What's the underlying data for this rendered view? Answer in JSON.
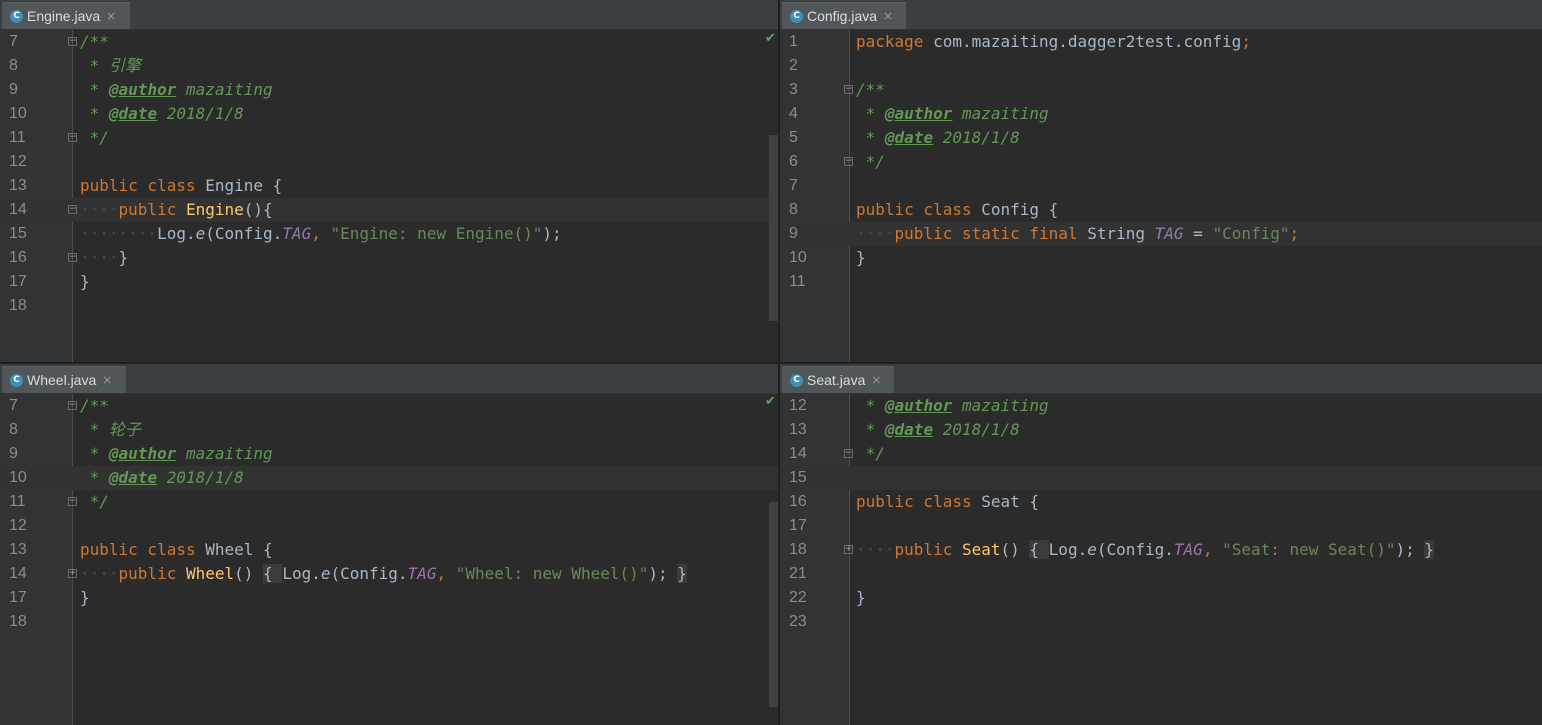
{
  "panes": {
    "engine": {
      "tab": {
        "label": "Engine.java",
        "close": "×"
      },
      "lines": [
        {
          "n": "7",
          "fold": "-",
          "tokens": [
            {
              "t": "/**",
              "c": "cm"
            }
          ]
        },
        {
          "n": "8",
          "tokens": [
            {
              "t": " * 引擎",
              "c": "cm"
            }
          ]
        },
        {
          "n": "9",
          "tokens": [
            {
              "t": " * ",
              "c": "cm"
            },
            {
              "t": "@author",
              "c": "tg"
            },
            {
              "t": " mazaiting",
              "c": "cm"
            }
          ]
        },
        {
          "n": "10",
          "tokens": [
            {
              "t": " * ",
              "c": "cm"
            },
            {
              "t": "@date",
              "c": "tg"
            },
            {
              "t": " 2018/1/8",
              "c": "cm"
            }
          ]
        },
        {
          "n": "11",
          "fold": "-",
          "tokens": [
            {
              "t": " */",
              "c": "cm"
            }
          ]
        },
        {
          "n": "12",
          "tokens": []
        },
        {
          "n": "13",
          "tokens": [
            {
              "t": "public class ",
              "c": "kw"
            },
            {
              "t": "Engine {",
              "c": "pl"
            }
          ]
        },
        {
          "n": "14",
          "fold": "-",
          "hl": true,
          "tokens": [
            {
              "t": "····",
              "c": "dot"
            },
            {
              "t": "public ",
              "c": "kw"
            },
            {
              "t": "Engine",
              "c": "fn"
            },
            {
              "t": "(){",
              "c": "pl"
            }
          ]
        },
        {
          "n": "15",
          "tokens": [
            {
              "t": "········",
              "c": "dot"
            },
            {
              "t": "Log.",
              "c": "pl"
            },
            {
              "t": "e",
              "c": "mi"
            },
            {
              "t": "(Config.",
              "c": "pl"
            },
            {
              "t": "TAG",
              "c": "cf"
            },
            {
              "t": ", ",
              "c": "kw"
            },
            {
              "t": "\"Engine: new Engine()\"",
              "c": "st"
            },
            {
              "t": ");",
              "c": "pl"
            }
          ]
        },
        {
          "n": "16",
          "fold": "-",
          "tokens": [
            {
              "t": "····",
              "c": "dot"
            },
            {
              "t": "}",
              "c": "pl"
            }
          ]
        },
        {
          "n": "17",
          "tokens": [
            {
              "t": "}",
              "c": "pl"
            }
          ]
        },
        {
          "n": "18",
          "tokens": []
        }
      ]
    },
    "config": {
      "tab": {
        "label": "Config.java",
        "close": "×"
      },
      "lines": [
        {
          "n": "1",
          "tokens": [
            {
              "t": "package ",
              "c": "kw"
            },
            {
              "t": "com.mazaiting.dagger2test.config",
              "c": "pl"
            },
            {
              "t": ";",
              "c": "kw"
            }
          ]
        },
        {
          "n": "2",
          "tokens": []
        },
        {
          "n": "3",
          "fold": "-",
          "tokens": [
            {
              "t": "/**",
              "c": "cm"
            }
          ]
        },
        {
          "n": "4",
          "tokens": [
            {
              "t": " * ",
              "c": "cm"
            },
            {
              "t": "@author",
              "c": "tg"
            },
            {
              "t": " mazaiting",
              "c": "cm"
            }
          ]
        },
        {
          "n": "5",
          "tokens": [
            {
              "t": " * ",
              "c": "cm"
            },
            {
              "t": "@date",
              "c": "tg"
            },
            {
              "t": " 2018/1/8",
              "c": "cm"
            }
          ]
        },
        {
          "n": "6",
          "fold": "-",
          "tokens": [
            {
              "t": " */",
              "c": "cm"
            }
          ]
        },
        {
          "n": "7",
          "tokens": []
        },
        {
          "n": "8",
          "tokens": [
            {
              "t": "public class ",
              "c": "kw"
            },
            {
              "t": "Config {",
              "c": "pl"
            }
          ]
        },
        {
          "n": "9",
          "hl": true,
          "tokens": [
            {
              "t": "····",
              "c": "dot"
            },
            {
              "t": "public static final ",
              "c": "kw"
            },
            {
              "t": "String ",
              "c": "pl"
            },
            {
              "t": "TAG",
              "c": "cf"
            },
            {
              "t": " = ",
              "c": "pl"
            },
            {
              "t": "\"Config\"",
              "c": "st"
            },
            {
              "t": ";",
              "c": "kw"
            }
          ]
        },
        {
          "n": "10",
          "tokens": [
            {
              "t": "}",
              "c": "pl"
            }
          ]
        },
        {
          "n": "11",
          "tokens": []
        }
      ]
    },
    "wheel": {
      "tab": {
        "label": "Wheel.java",
        "close": "×"
      },
      "lines": [
        {
          "n": "7",
          "fold": "-",
          "tokens": [
            {
              "t": "/**",
              "c": "cm"
            }
          ]
        },
        {
          "n": "8",
          "tokens": [
            {
              "t": " * 轮子",
              "c": "cm"
            }
          ]
        },
        {
          "n": "9",
          "tokens": [
            {
              "t": " * ",
              "c": "cm"
            },
            {
              "t": "@author",
              "c": "tg"
            },
            {
              "t": " mazaiting",
              "c": "cm"
            }
          ]
        },
        {
          "n": "10",
          "hl": true,
          "tokens": [
            {
              "t": " * ",
              "c": "cm"
            },
            {
              "t": "@date",
              "c": "tg"
            },
            {
              "t": " 2018/1/8",
              "c": "cm"
            }
          ]
        },
        {
          "n": "11",
          "fold": "-",
          "tokens": [
            {
              "t": " */",
              "c": "cm"
            }
          ]
        },
        {
          "n": "12",
          "tokens": []
        },
        {
          "n": "13",
          "tokens": [
            {
              "t": "public class ",
              "c": "kw"
            },
            {
              "t": "Wheel {",
              "c": "pl"
            }
          ]
        },
        {
          "n": "14",
          "fold": "+",
          "tokens": [
            {
              "t": "····",
              "c": "dot"
            },
            {
              "t": "public ",
              "c": "kw"
            },
            {
              "t": "Wheel",
              "c": "fn"
            },
            {
              "t": "() ",
              "c": "pl"
            },
            {
              "t": "{ ",
              "c": "folded"
            },
            {
              "t": "Log.",
              "c": "pl"
            },
            {
              "t": "e",
              "c": "mi"
            },
            {
              "t": "(Config.",
              "c": "pl"
            },
            {
              "t": "TAG",
              "c": "cf"
            },
            {
              "t": ", ",
              "c": "kw"
            },
            {
              "t": "\"Wheel: new Wheel()\"",
              "c": "st"
            },
            {
              "t": "); ",
              "c": "pl"
            },
            {
              "t": "}",
              "c": "folded"
            }
          ]
        },
        {
          "n": "17",
          "tokens": [
            {
              "t": "}",
              "c": "pl"
            }
          ]
        },
        {
          "n": "18",
          "tokens": []
        }
      ]
    },
    "seat": {
      "tab": {
        "label": "Seat.java",
        "close": "×"
      },
      "lines": [
        {
          "n": "12",
          "tokens": [
            {
              "t": " * ",
              "c": "cm"
            },
            {
              "t": "@author",
              "c": "tg"
            },
            {
              "t": " mazaiting",
              "c": "cm"
            }
          ]
        },
        {
          "n": "13",
          "tokens": [
            {
              "t": " * ",
              "c": "cm"
            },
            {
              "t": "@date",
              "c": "tg"
            },
            {
              "t": " 2018/1/8",
              "c": "cm"
            }
          ]
        },
        {
          "n": "14",
          "fold": "-",
          "tokens": [
            {
              "t": " */",
              "c": "cm"
            }
          ]
        },
        {
          "n": "15",
          "hl": true,
          "tokens": []
        },
        {
          "n": "16",
          "tokens": [
            {
              "t": "public class ",
              "c": "kw"
            },
            {
              "t": "Seat {",
              "c": "pl"
            }
          ]
        },
        {
          "n": "17",
          "tokens": []
        },
        {
          "n": "18",
          "fold": "+",
          "tokens": [
            {
              "t": "····",
              "c": "dot"
            },
            {
              "t": "public ",
              "c": "kw"
            },
            {
              "t": "Seat",
              "c": "fn"
            },
            {
              "t": "() ",
              "c": "pl"
            },
            {
              "t": "{ ",
              "c": "folded"
            },
            {
              "t": "Log.",
              "c": "pl"
            },
            {
              "t": "e",
              "c": "mi"
            },
            {
              "t": "(Config.",
              "c": "pl"
            },
            {
              "t": "TAG",
              "c": "cf"
            },
            {
              "t": ", ",
              "c": "kw"
            },
            {
              "t": "\"Seat: new Seat()\"",
              "c": "st"
            },
            {
              "t": "); ",
              "c": "pl"
            },
            {
              "t": "}",
              "c": "folded"
            }
          ]
        },
        {
          "n": "21",
          "tokens": []
        },
        {
          "n": "22",
          "tokens": [
            {
              "t": "}",
              "c": "pl"
            }
          ]
        },
        {
          "n": "23",
          "tokens": []
        }
      ]
    }
  },
  "icons": {
    "class_icon": "C",
    "inspection_ok": "✔"
  },
  "colors": {
    "background": "#2b2b2b",
    "keyword": "#cc7832",
    "comment": "#629755",
    "string": "#6a8759",
    "constant": "#9876aa",
    "method": "#ffc66d"
  }
}
